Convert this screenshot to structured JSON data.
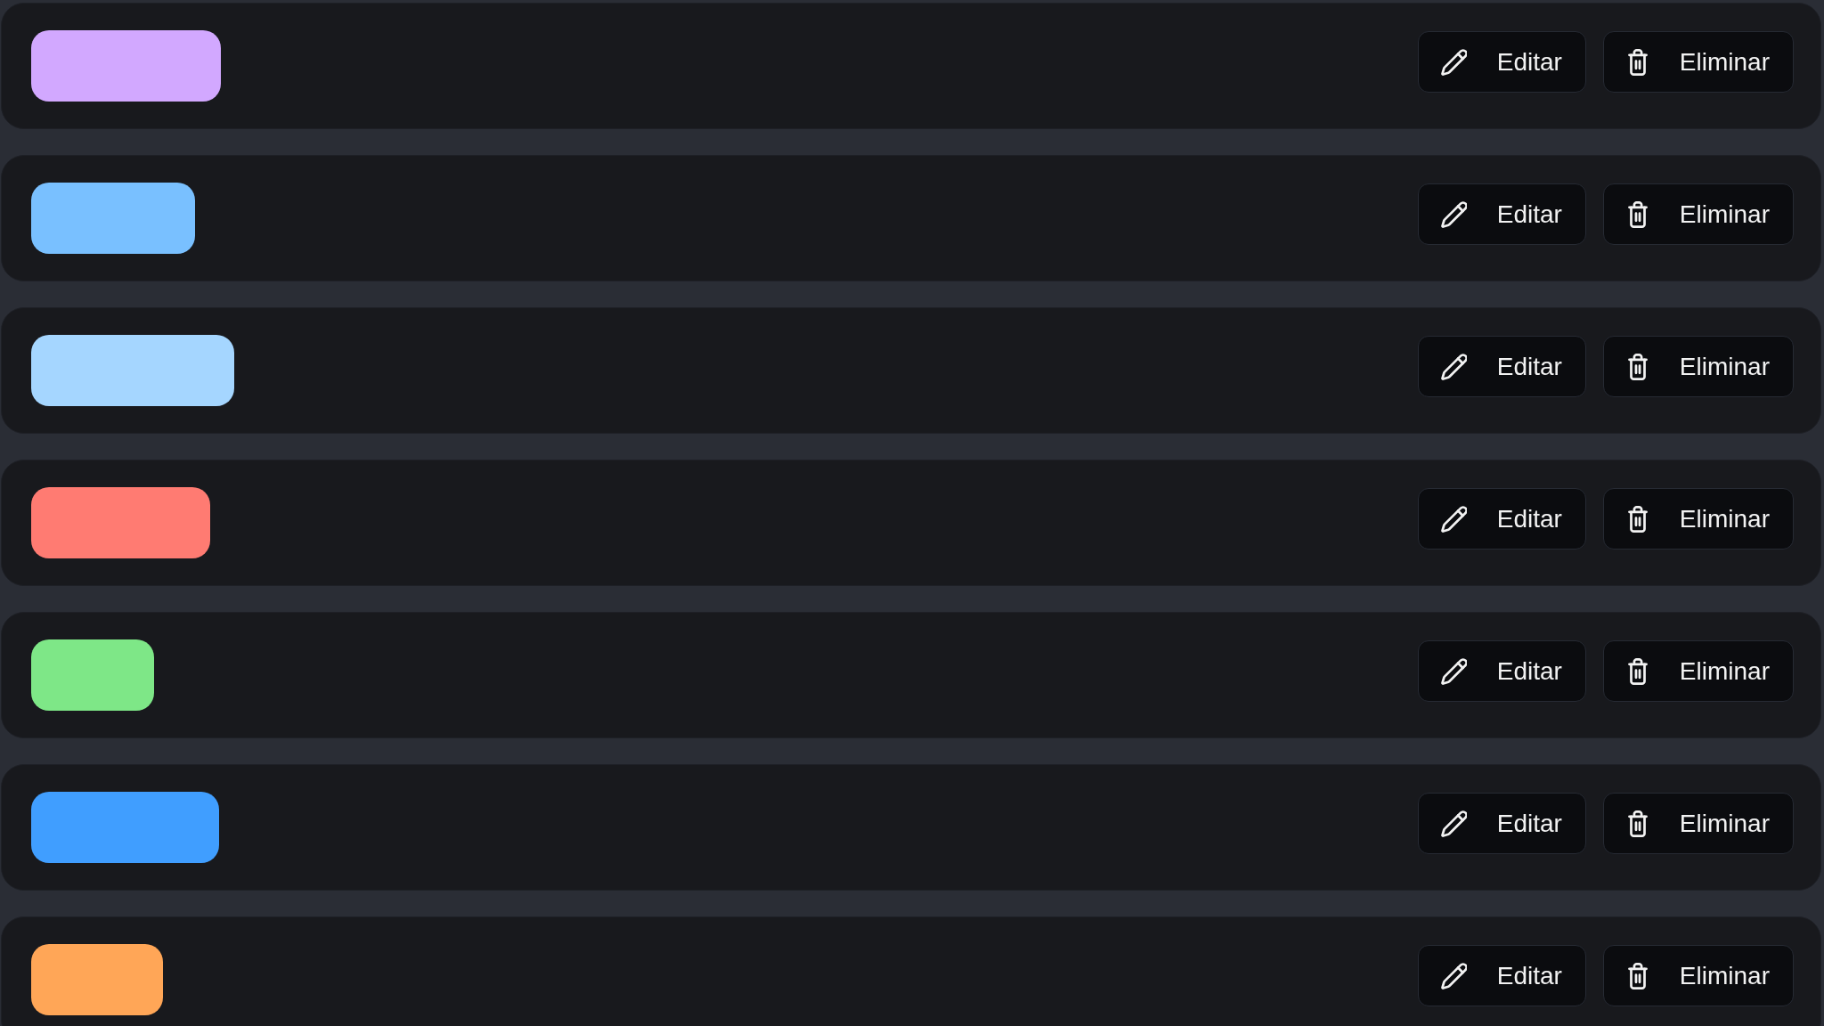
{
  "rows": [
    {
      "color": "#d2a8ff",
      "actions": [
        {
          "kind": "edit",
          "label": "Editar"
        },
        {
          "kind": "delete",
          "label": "Eliminar"
        }
      ]
    },
    {
      "color": "#79c0ff",
      "actions": [
        {
          "kind": "edit",
          "label": "Editar"
        },
        {
          "kind": "delete",
          "label": "Eliminar"
        }
      ]
    },
    {
      "color": "#a5d6ff",
      "actions": [
        {
          "kind": "edit",
          "label": "Editar"
        },
        {
          "kind": "delete",
          "label": "Eliminar"
        }
      ]
    },
    {
      "color": "#ff7b72",
      "actions": [
        {
          "kind": "edit",
          "label": "Editar"
        },
        {
          "kind": "delete",
          "label": "Eliminar"
        }
      ]
    },
    {
      "color": "#7ee787",
      "actions": [
        {
          "kind": "edit",
          "label": "Editar"
        },
        {
          "kind": "delete",
          "label": "Eliminar"
        }
      ]
    },
    {
      "color": "#409eff",
      "actions": [
        {
          "kind": "edit",
          "label": "Editar"
        },
        {
          "kind": "delete",
          "label": "Eliminar"
        }
      ]
    },
    {
      "color": "#ffa657",
      "actions": [
        {
          "kind": "edit",
          "label": "Editar"
        },
        {
          "kind": "delete",
          "label": "Eliminar"
        }
      ]
    }
  ]
}
